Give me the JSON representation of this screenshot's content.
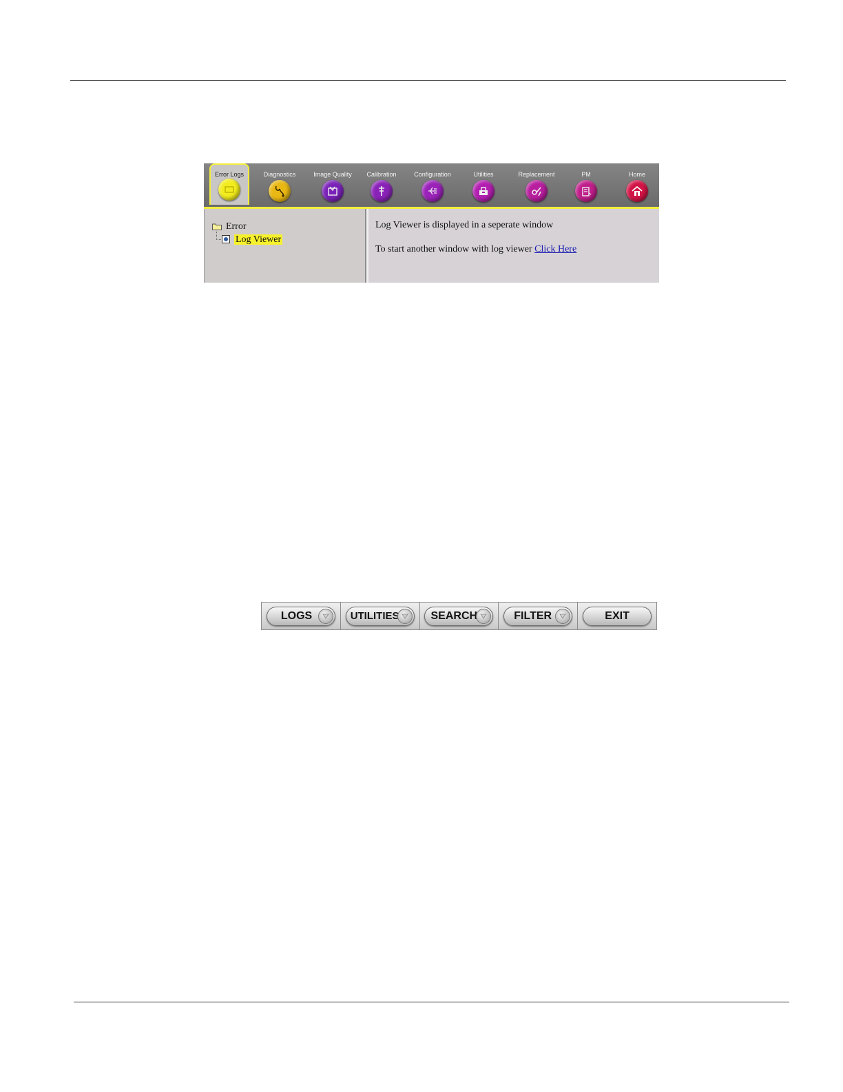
{
  "tabs": [
    {
      "label": "Error Logs",
      "icon": "error-logs-icon",
      "color": "#f2ec1e",
      "active": true
    },
    {
      "label": "Diagnostics",
      "icon": "stethoscope-icon",
      "color": "#e9b814",
      "active": false
    },
    {
      "label": "Image Quality",
      "icon": "image-quality-icon",
      "color": "#7a22b8",
      "active": false
    },
    {
      "label": "Calibration",
      "icon": "calibration-icon",
      "color": "#8a22b8",
      "active": false
    },
    {
      "label": "Configuration",
      "icon": "configuration-icon",
      "color": "#9a22b8",
      "active": false
    },
    {
      "label": "Utilities",
      "icon": "utilities-icon",
      "color": "#b21eb0",
      "active": false
    },
    {
      "label": "Replacement",
      "icon": "replacement-icon",
      "color": "#b81e9e",
      "active": false
    },
    {
      "label": "PM",
      "icon": "pm-icon",
      "color": "#c01e8a",
      "active": false
    },
    {
      "label": "Home",
      "icon": "home-icon",
      "color": "#d21446",
      "active": false
    }
  ],
  "tree": {
    "root": "Error",
    "child": "Log Viewer"
  },
  "content": {
    "line1": "Log Viewer is displayed in a seperate window",
    "line2_prefix": "To start another window with log viewer",
    "link": "Click Here"
  },
  "softkeys": [
    {
      "label": "LOGS",
      "dropdown": true
    },
    {
      "label": "UTILITIES",
      "dropdown": true
    },
    {
      "label": "SEARCH",
      "dropdown": true
    },
    {
      "label": "FILTER",
      "dropdown": true
    },
    {
      "label": "EXIT",
      "dropdown": false
    }
  ],
  "colors": {
    "tab_bar": "#7a7a7a",
    "highlight": "#f6f12c",
    "panel": "#d4d0d4"
  }
}
